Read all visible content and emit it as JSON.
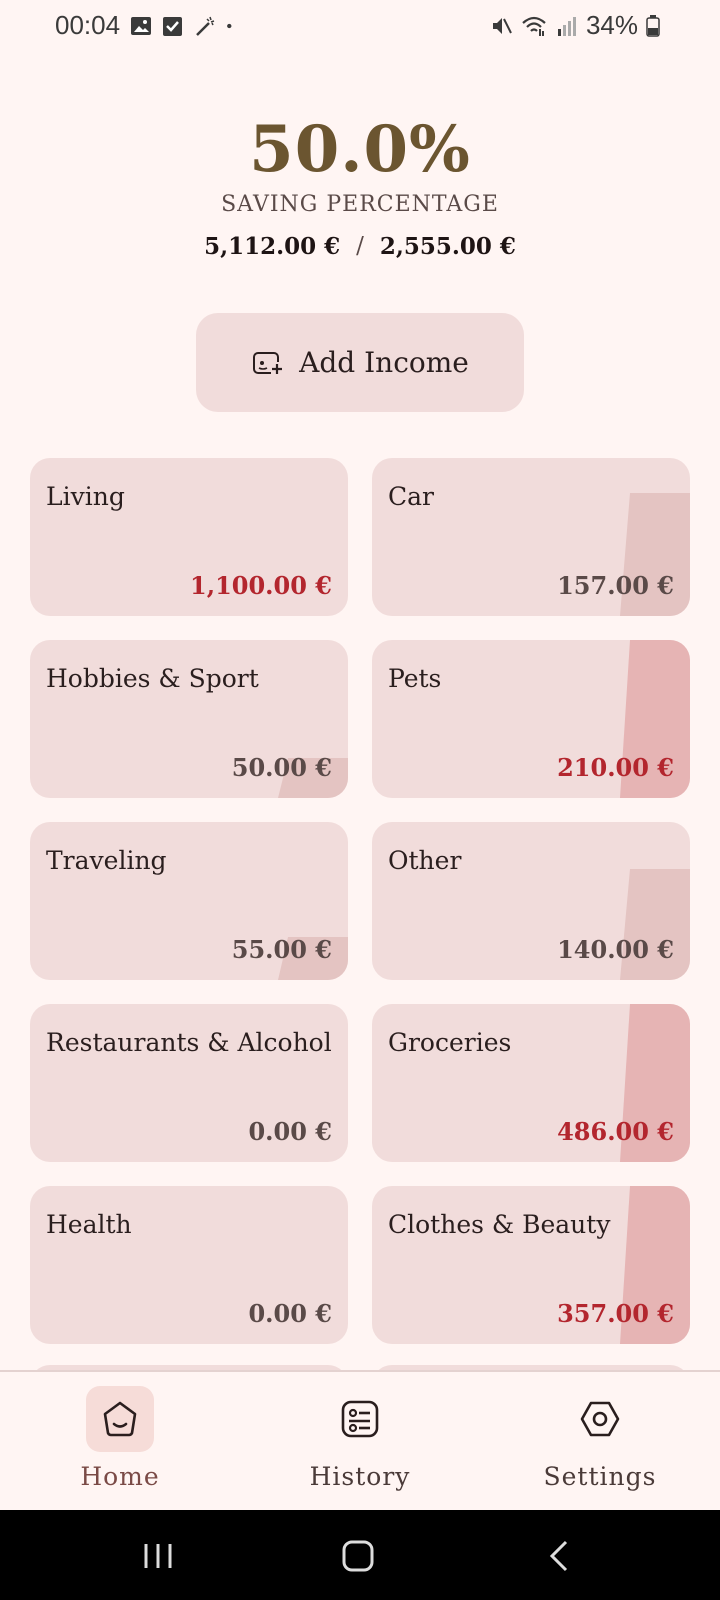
{
  "status_bar": {
    "time": "00:04",
    "battery": "34%",
    "icons": [
      "image-icon",
      "checkbox-icon",
      "magic-wand-icon",
      "dot-icon",
      "mute-icon",
      "wifi-icon",
      "signal-icon",
      "battery-icon"
    ]
  },
  "summary": {
    "saving_percentage": "50.0%",
    "label": "SAVING PERCENTAGE",
    "income": "5,112.00 €",
    "separator": "/",
    "saved": "2,555.00 €"
  },
  "add_income": {
    "label": "Add Income",
    "icon": "add-income-icon"
  },
  "categories": [
    {
      "name": "Living",
      "amount": "1,100.00 €",
      "over": true,
      "fill": 0.0
    },
    {
      "name": "Car",
      "amount": "157.00 €",
      "over": false,
      "fill": 0.78
    },
    {
      "name": "Hobbies & Sport",
      "amount": "50.00 €",
      "over": false,
      "fill": 0.25
    },
    {
      "name": "Pets",
      "amount": "210.00 €",
      "over": true,
      "fill": 1.0
    },
    {
      "name": "Traveling",
      "amount": "55.00 €",
      "over": false,
      "fill": 0.27
    },
    {
      "name": "Other",
      "amount": "140.00 €",
      "over": false,
      "fill": 0.7
    },
    {
      "name": "Restaurants & Alcohol",
      "amount": "0.00 €",
      "over": false,
      "fill": 0.0
    },
    {
      "name": "Groceries",
      "amount": "486.00 €",
      "over": true,
      "fill": 1.0
    },
    {
      "name": "Health",
      "amount": "0.00 €",
      "over": false,
      "fill": 0.0
    },
    {
      "name": "Clothes & Beauty",
      "amount": "357.00 €",
      "over": true,
      "fill": 1.0
    }
  ],
  "colors": {
    "background": "#fff5f3",
    "card": "#f1dcdb",
    "fill_normal": "#e4c4c2",
    "fill_over": "#e6b4b4",
    "accent_gold": "#6b5530",
    "over_red": "#b3262e"
  },
  "bottom_nav": {
    "items": [
      {
        "label": "Home",
        "icon": "home-icon",
        "active": true
      },
      {
        "label": "History",
        "icon": "history-icon",
        "active": false
      },
      {
        "label": "Settings",
        "icon": "settings-icon",
        "active": false
      }
    ]
  },
  "system_nav": {
    "icons": [
      "recents-icon",
      "home-button-icon",
      "back-icon"
    ]
  }
}
